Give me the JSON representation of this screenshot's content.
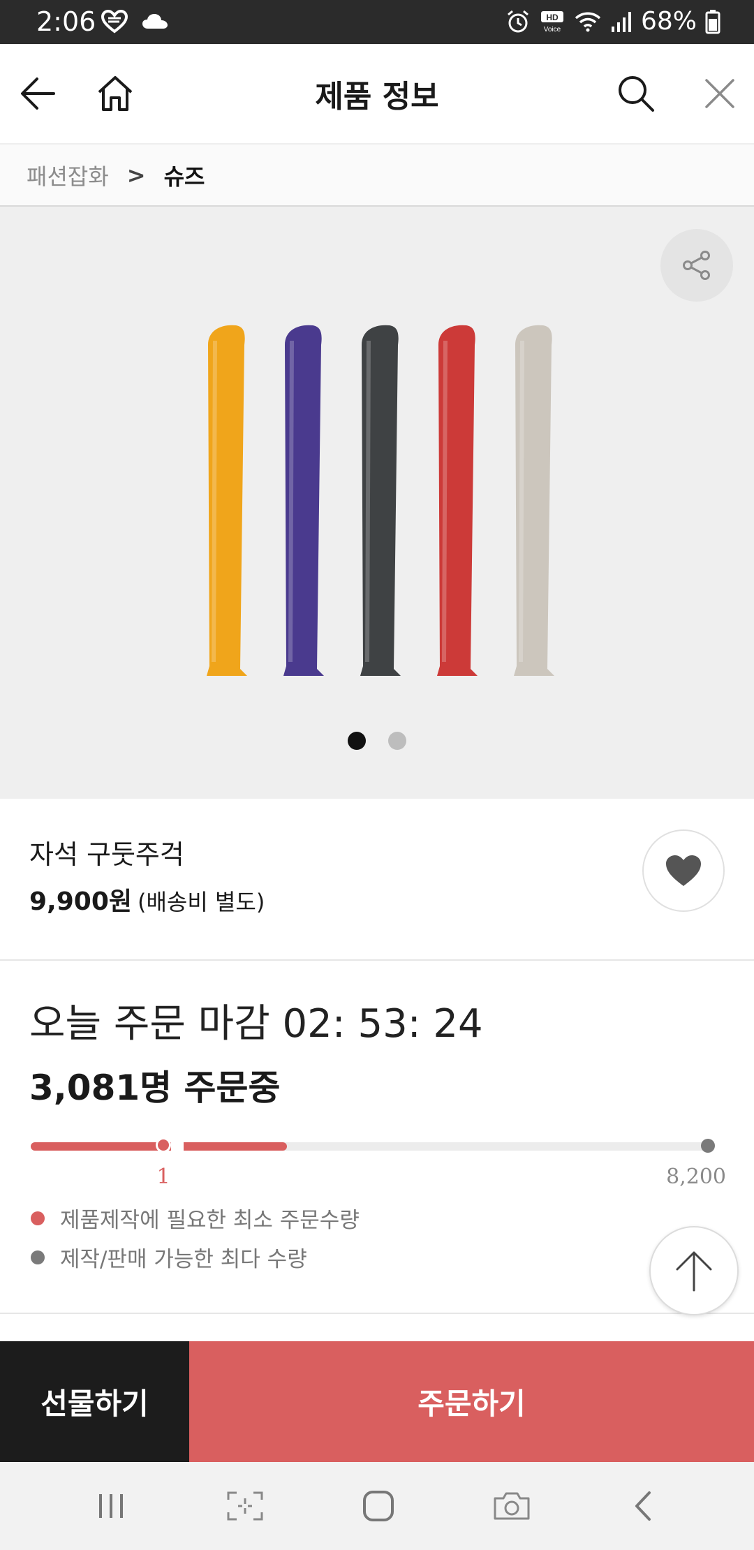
{
  "status_bar": {
    "time": "2:06",
    "battery": "68%"
  },
  "header": {
    "title": "제품 정보"
  },
  "breadcrumb": {
    "parent": "패션잡화",
    "separator": ">",
    "current": "슈즈"
  },
  "gallery": {
    "image_count": 2,
    "active_index": 0,
    "shoehorn_colors": [
      "#f0a51b",
      "#4a3a8e",
      "#3f4244",
      "#cc3a38",
      "#ccc6bd"
    ]
  },
  "product": {
    "name": "자석 구둣주걱",
    "price": "9,900원",
    "shipping_note": "(배송비 별도)"
  },
  "order_status": {
    "deadline_text": "오늘 주문 마감 02: 53: 24",
    "ordering_count_text": "3,081명 주문중",
    "min_quantity_label": "1",
    "max_quantity_label": "8,200",
    "min_quantity": 1,
    "max_quantity": 8200,
    "current_orders": 3081,
    "legend_min": "제품제작에 필요한 최소 주문수량",
    "legend_max": "제작/판매 가능한 최다 수량"
  },
  "colors": {
    "accent": "#d95f5f",
    "dark": "#1c1c1c",
    "max_marker": "#7a7a7a"
  },
  "actions": {
    "gift_label": "선물하기",
    "order_label": "주문하기"
  },
  "icons": {
    "back": "arrow-left-icon",
    "home": "home-icon",
    "search": "search-icon",
    "close": "close-icon",
    "share": "share-icon",
    "like": "heart-icon",
    "scroll_top": "arrow-up-icon"
  }
}
